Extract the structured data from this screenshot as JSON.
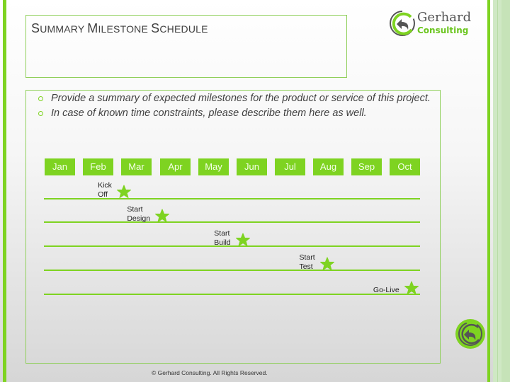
{
  "slide": {
    "title": {
      "first_S": "S",
      "rest1": "UMMARY ",
      "first_M": "M",
      "rest2": "ILESTONE ",
      "first_S2": "S",
      "rest3": "CHEDULE"
    },
    "logo": {
      "line1": "Gerhard",
      "line2": "Consulting",
      "icon": "gerhard-logo-icon"
    },
    "bullets": [
      "Provide a summary of expected milestones for the product or service of this project.",
      "In case of known time constraints, please describe them here as well."
    ],
    "footer": "© Gerhard Consulting. All Rights Reserved."
  },
  "timeline": {
    "months": [
      "Jan",
      "Feb",
      "Mar",
      "Apr",
      "May",
      "Jun",
      "Jul",
      "Aug",
      "Sep",
      "Oct"
    ],
    "milestones": [
      {
        "label_line1": "Kick",
        "label_line2": "Off",
        "month_index": 1.2,
        "icon": "star-icon"
      },
      {
        "label_line1": "Start",
        "label_line2": "Design",
        "month_index": 2.2,
        "icon": "star-icon"
      },
      {
        "label_line1": "Start",
        "label_line2": "Build",
        "month_index": 4.3,
        "icon": "star-icon"
      },
      {
        "label_line1": "Start",
        "label_line2": "Test",
        "month_index": 6.5,
        "icon": "star-icon"
      },
      {
        "label_line1": "Go-Live",
        "label_line2": "",
        "month_index": 8.7,
        "icon": "star-icon"
      }
    ],
    "accent_color": "#7ed321"
  }
}
